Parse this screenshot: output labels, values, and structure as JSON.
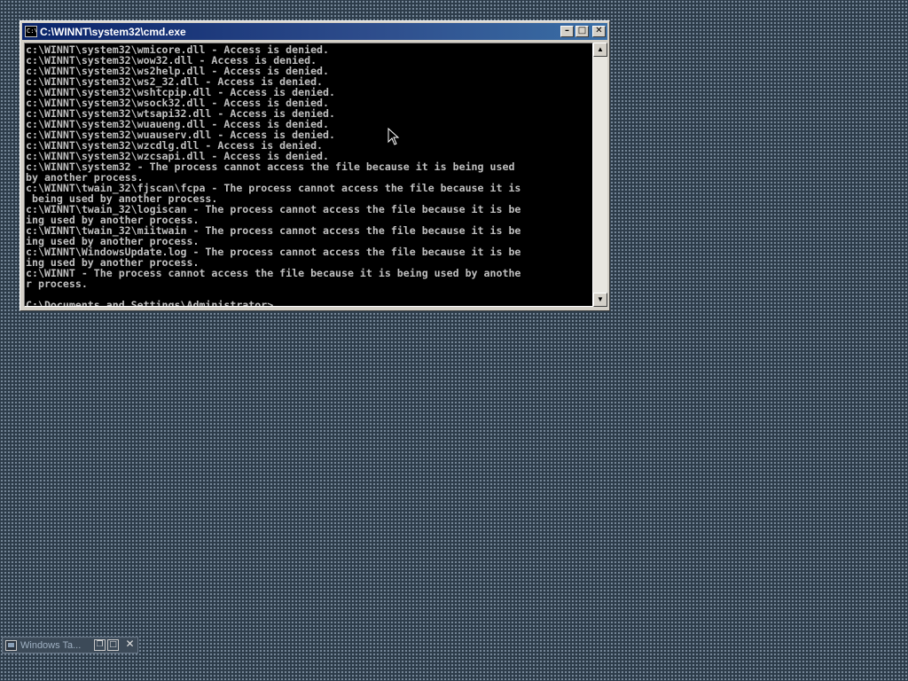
{
  "window": {
    "title": "C:\\WINNT\\system32\\cmd.exe",
    "icon_label": "C:\\",
    "icon": "console-icon",
    "minimize": "minimize-icon",
    "maximize": "maximize-icon",
    "close": "close-icon"
  },
  "console": {
    "lines": [
      "c:\\WINNT\\system32\\wmicore.dll - Access is denied.",
      "c:\\WINNT\\system32\\wow32.dll - Access is denied.",
      "c:\\WINNT\\system32\\ws2help.dll - Access is denied.",
      "c:\\WINNT\\system32\\ws2_32.dll - Access is denied.",
      "c:\\WINNT\\system32\\wshtcpip.dll - Access is denied.",
      "c:\\WINNT\\system32\\wsock32.dll - Access is denied.",
      "c:\\WINNT\\system32\\wtsapi32.dll - Access is denied.",
      "c:\\WINNT\\system32\\wuaueng.dll - Access is denied.",
      "c:\\WINNT\\system32\\wuauserv.dll - Access is denied.",
      "c:\\WINNT\\system32\\wzcdlg.dll - Access is denied.",
      "c:\\WINNT\\system32\\wzcsapi.dll - Access is denied.",
      "c:\\WINNT\\system32 - The process cannot access the file because it is being used",
      "by another process.",
      "c:\\WINNT\\twain_32\\fjscan\\fcpa - The process cannot access the file because it is",
      " being used by another process.",
      "c:\\WINNT\\twain_32\\logiscan - The process cannot access the file because it is be",
      "ing used by another process.",
      "c:\\WINNT\\twain_32\\miitwain - The process cannot access the file because it is be",
      "ing used by another process.",
      "c:\\WINNT\\WindowsUpdate.log - The process cannot access the file because it is be",
      "ing used by another process.",
      "c:\\WINNT - The process cannot access the file because it is being used by anothe",
      "r process.",
      ""
    ],
    "prompt": "C:\\Documents and Settings\\Administrator>"
  },
  "scrollbar": {
    "up": "scroll-up-arrow-icon",
    "down": "scroll-down-arrow-icon"
  },
  "minimized_window": {
    "title": "Windows Ta...",
    "icon": "computer-icon",
    "restore": "restore-icon",
    "maximize": "maximize-icon",
    "close": "close-icon"
  },
  "colors": {
    "desktop": "#2d3c4a",
    "titlebar": "#0a246a",
    "console_bg": "#000000",
    "console_text": "#c0c0c0"
  }
}
